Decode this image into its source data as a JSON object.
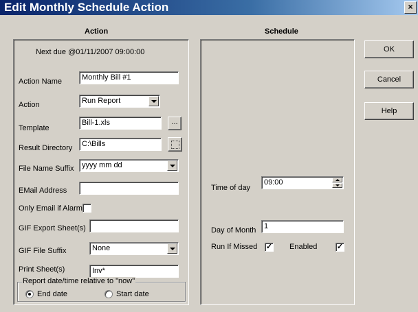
{
  "window": {
    "title": "Edit Monthly Schedule Action",
    "close_glyph": "×"
  },
  "action": {
    "header": "Action",
    "next_due": "Next due @01/11/2007 09:00:00",
    "action_name_label": "Action Name",
    "action_name_value": "Monthly Bill #1",
    "action_label": "Action",
    "action_value": "Run Report",
    "template_label": "Template",
    "template_value": "Bill-1.xls",
    "template_browse": "...",
    "result_dir_label": "Result Directory",
    "result_dir_value": "C:\\Bills",
    "suffix_label": "File Name Suffix",
    "suffix_value": "yyyy mm dd",
    "email_label": "EMail Address",
    "email_value": "",
    "only_email_label": "Only Email if Alarm",
    "only_email_checked": false,
    "gif_export_label": "GIF Export Sheet(s)",
    "gif_export_value": "",
    "gif_suffix_label": "GIF File Suffix",
    "gif_suffix_value": "None",
    "print_label": "Print Sheet(s)",
    "print_value": "Inv*",
    "report_group_label": "Report date/time relative to \"now\"",
    "end_date_label": "End date",
    "start_date_label": "Start date",
    "selected_relative": "end"
  },
  "schedule": {
    "header": "Schedule",
    "time_label": "Time of day",
    "time_value": "09:00",
    "day_label": "Day of Month",
    "day_value": "1",
    "run_missed_label": "Run If Missed",
    "run_missed_checked": true,
    "enabled_label": "Enabled",
    "enabled_checked": true,
    "check_glyph": "✓"
  },
  "buttons": {
    "ok": "OK",
    "cancel": "Cancel",
    "help": "Help"
  }
}
